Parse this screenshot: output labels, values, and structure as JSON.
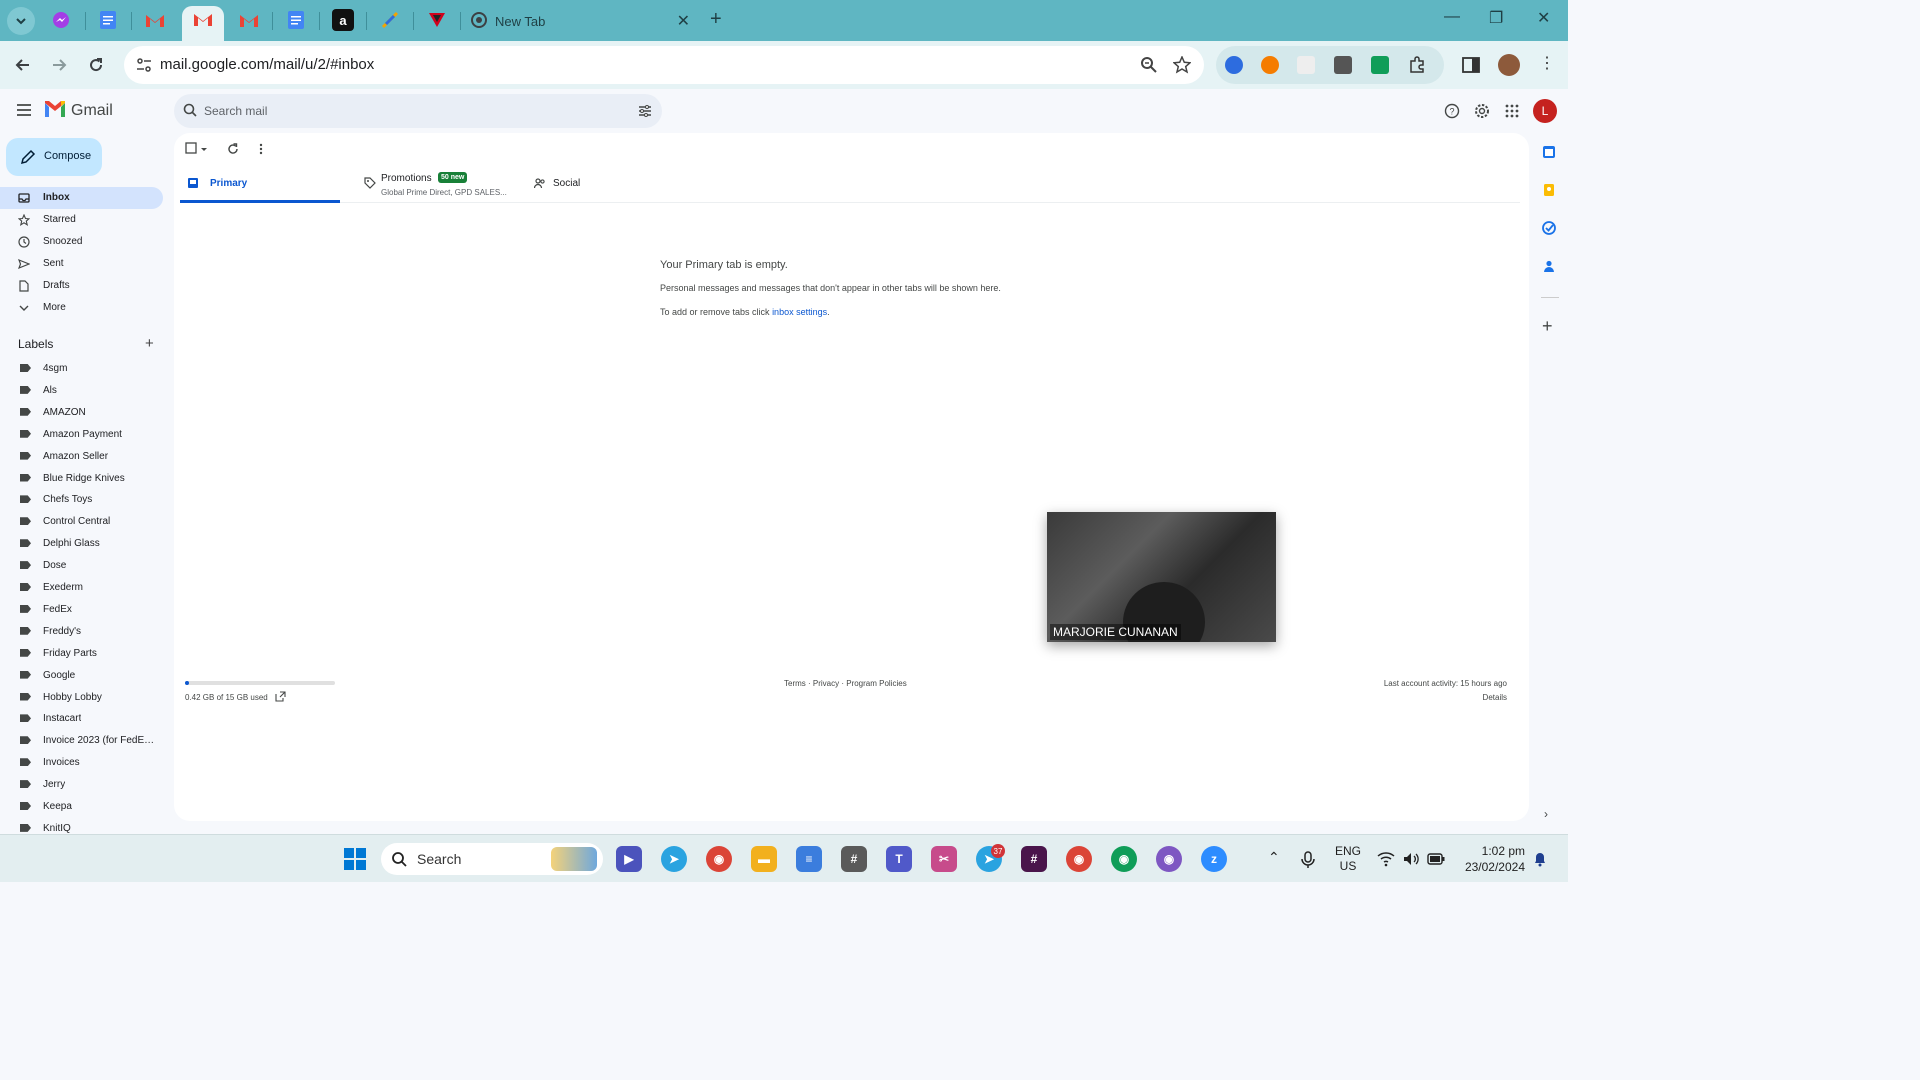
{
  "browser": {
    "newtab_title": "New Tab",
    "url": "mail.google.com/mail/u/2/#inbox"
  },
  "gmail": {
    "product_name": "Gmail",
    "search_placeholder": "Search mail",
    "compose_label": "Compose",
    "avatar_letter": "L",
    "nav": [
      {
        "label": "Inbox",
        "icon": "inbox-icon",
        "selected": true
      },
      {
        "label": "Starred",
        "icon": "star-icon"
      },
      {
        "label": "Snoozed",
        "icon": "clock-icon"
      },
      {
        "label": "Sent",
        "icon": "send-icon"
      },
      {
        "label": "Drafts",
        "icon": "draft-icon"
      },
      {
        "label": "More",
        "icon": "chevron-down-icon"
      }
    ],
    "labels_heading": "Labels",
    "labels": [
      "4sgm",
      "Als",
      "AMAZON",
      "Amazon Payment",
      "Amazon Seller",
      "Blue Ridge Knives",
      "Chefs Toys",
      "Control Central",
      "Delphi Glass",
      "Dose",
      "Exederm",
      "FedEx",
      "Freddy's",
      "Friday Parts",
      "Google",
      "Hobby Lobby",
      "Instacart",
      "Invoice 2023 (for FedEx ...",
      "Invoices",
      "Jerry",
      "Keepa",
      "KnitIQ"
    ],
    "tabs": {
      "primary": "Primary",
      "promotions": "Promotions",
      "promotions_badge": "50 new",
      "promotions_sub": "Global Prime Direct, GPD SALES...",
      "social": "Social"
    },
    "empty": {
      "title": "Your Primary tab is empty.",
      "desc": "Personal messages and messages that don't appear in other tabs will be shown here.",
      "hint_prefix": "To add or remove tabs click ",
      "hint_link": "inbox settings",
      "hint_suffix": "."
    },
    "footer": {
      "storage": "0.42 GB of 15 GB used",
      "storage_fraction": 0.028,
      "terms": "Terms",
      "privacy": "Privacy",
      "policies": "Program Policies",
      "sep": " · ",
      "last_activity": "Last account activity: 15 hours ago",
      "details": "Details"
    },
    "video_name": "MARJORIE CUNANAN"
  },
  "taskbar": {
    "search_placeholder": "Search",
    "telegram_badge": "37",
    "lang_top": "ENG",
    "lang_bottom": "US",
    "time": "1:02 pm",
    "date": "23/02/2024"
  },
  "colors": {
    "accent": "#0b57d0",
    "tabstrip": "#5fb6c2",
    "badge_green": "#188038",
    "avatar_red": "#c5221f"
  }
}
